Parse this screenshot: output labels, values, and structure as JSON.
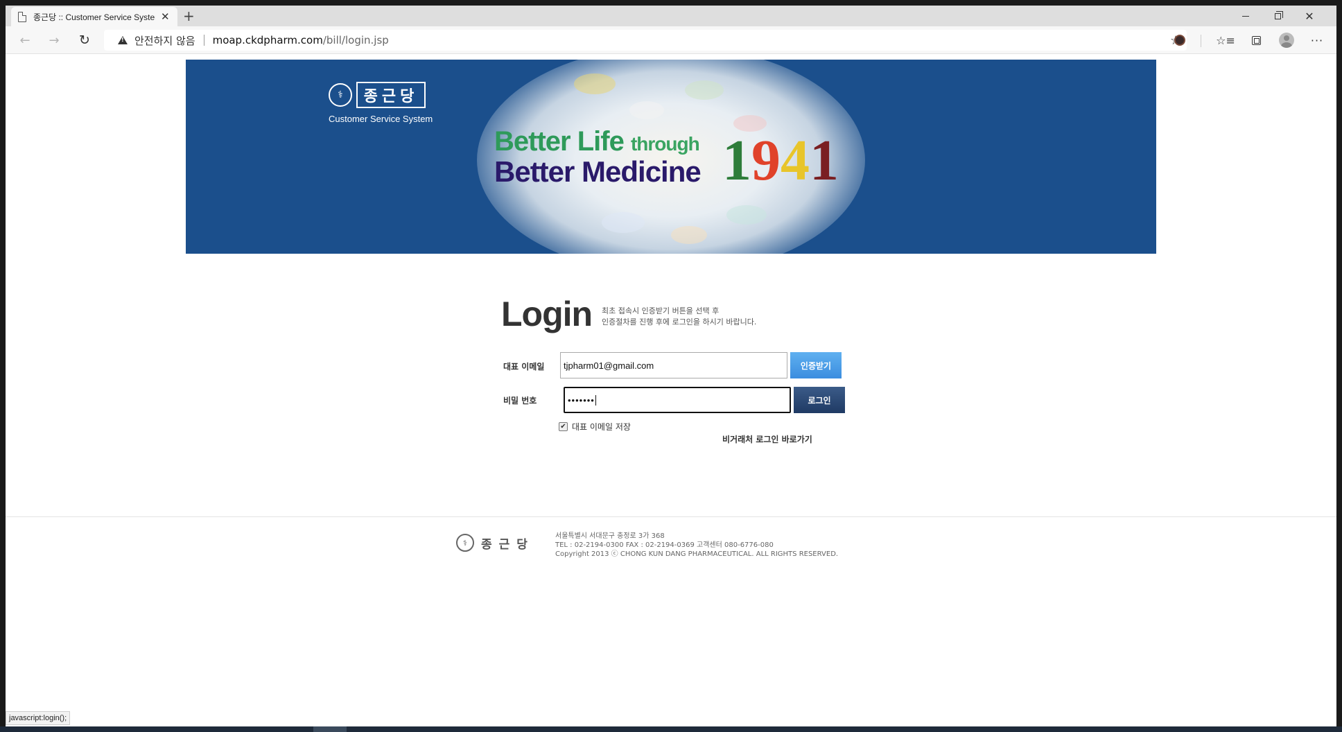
{
  "browser": {
    "tab_title": "종근당 :: Customer Service System",
    "tab_close": "✕",
    "new_tab": "+",
    "security_label": "안전하지 않음",
    "url_host": "moap.ckdpharm.com",
    "url_path": "/bill/login.jsp",
    "status_tip": "javascript:login();",
    "icons": [
      "back-icon",
      "forward-icon",
      "reload-icon",
      "warning-icon",
      "star-icon",
      "extension-icon",
      "favorites-icon",
      "collections-icon",
      "profile-icon",
      "more-icon"
    ]
  },
  "banner": {
    "logo_name": "종근당",
    "logo_sub": "Customer Service System",
    "slogan_line1_a": "Better Life",
    "slogan_line1_b": "through",
    "slogan_line2": "Better Medicine",
    "year": [
      "1",
      "9",
      "4",
      "1"
    ],
    "bg_color": "#1b4f8c"
  },
  "login": {
    "title": "Login",
    "desc_line1": "최초 접속시 인증받기 버튼을 선택 후",
    "desc_line2": "인증절차를 진행 후에 로그인을 하시기 바랍니다.",
    "email_label": "대표 이메일",
    "email_value": "tjpharm01@gmail.com",
    "password_label": "비밀 번호",
    "password_value": "•••••••",
    "cert_button": "인증받기",
    "login_button": "로그인",
    "save_email_label": "대표 이메일 저장",
    "save_email_checked": true,
    "nontrade_link": "비거래처 로그인 바로가기"
  },
  "footer": {
    "logo_name": "종근당",
    "address": "서울특별시 서대문구 충정로 3가 368",
    "contact": "TEL : 02-2194-0300 FAX : 02-2194-0369 고객센터 080-6776-080",
    "copyright": "Copyright 2013 ⓒ CHONG KUN DANG PHARMACEUTICAL. ALL RIGHTS RESERVED."
  }
}
